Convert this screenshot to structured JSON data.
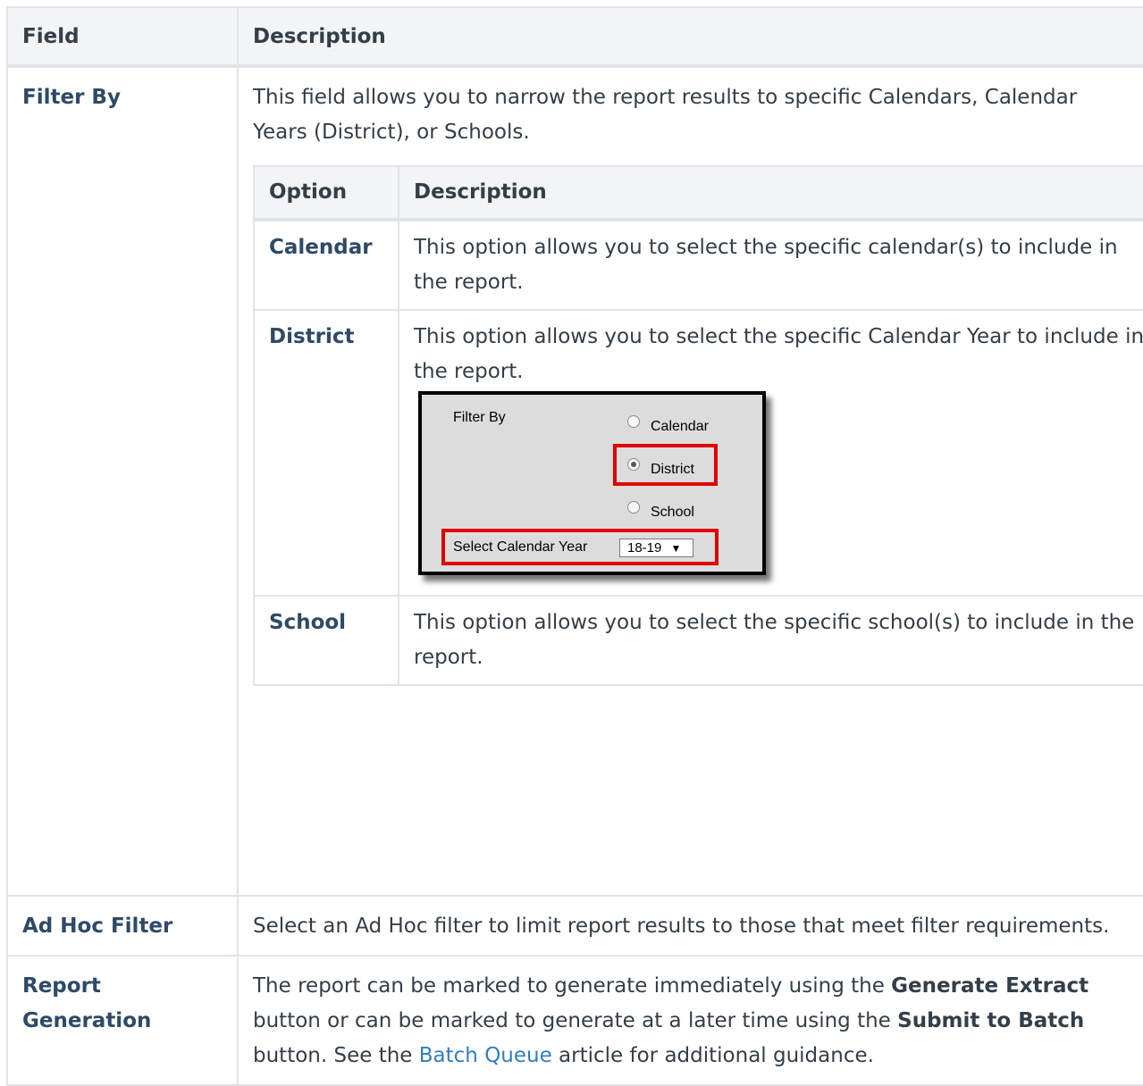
{
  "header": {
    "field": "Field",
    "description": "Description"
  },
  "rows": {
    "filter_by": {
      "label": "Filter By",
      "description": "This field allows you to narrow the report results to specific Calendars, Calendar Years (District), or Schools."
    },
    "ad_hoc": {
      "label": "Ad Hoc Filter",
      "description": "Select an Ad Hoc filter to limit report results to those that meet filter requirements."
    },
    "report_generation": {
      "label": "Report Generation",
      "text1": "The report can be marked to generate immediately using the ",
      "bold1": "Generate Extract",
      "text2": " button or can be marked to generate at a later time using the ",
      "bold2": "Submit to Batch",
      "text3": " button. See the ",
      "link": "Batch Queue",
      "text4": " article for additional guidance."
    }
  },
  "options_table": {
    "header": {
      "option": "Option",
      "description": "Description"
    },
    "rows": [
      {
        "option": "Calendar",
        "description": "This option allows you to select the specific calendar(s) to include in the report."
      },
      {
        "option": "District",
        "description": "This option allows you to select the specific Calendar Year to include in the report."
      },
      {
        "option": "School",
        "description": "This option allows you to select the specific school(s) to include in the report."
      }
    ]
  },
  "screenshot": {
    "filter_label": "Filter By",
    "radio_calendar": "Calendar",
    "radio_district": "District",
    "radio_school": "School",
    "selected_radio": "District",
    "year_label": "Select Calendar Year",
    "year_value": "18-19",
    "dropdown_arrow": "▼",
    "highlight_color": "#e10000"
  }
}
